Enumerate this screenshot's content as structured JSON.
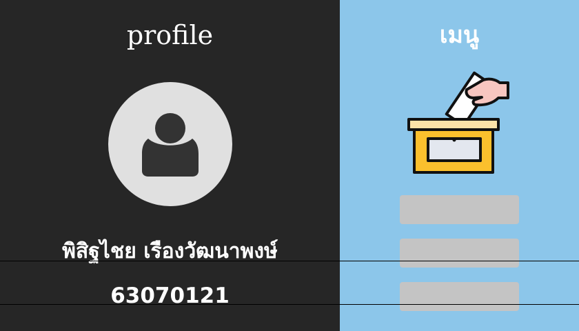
{
  "profile": {
    "title": "profile",
    "avatar_icon": "user-icon",
    "name": "พิสิฐไชย เรืองวัฒนาพงษ์",
    "student_id": "63070121"
  },
  "menu": {
    "title": "เมนู",
    "illustration_icon": "ballot-box-icon",
    "buttons": [
      {
        "label": ""
      },
      {
        "label": ""
      },
      {
        "label": ""
      }
    ]
  },
  "colors": {
    "left_background": "#262626",
    "right_background": "#8cc6ea",
    "avatar_circle": "#e0e0e0",
    "avatar_glyph": "#333333",
    "menu_button": "#c4c4c4",
    "ballot_box": "#fbc02d"
  }
}
